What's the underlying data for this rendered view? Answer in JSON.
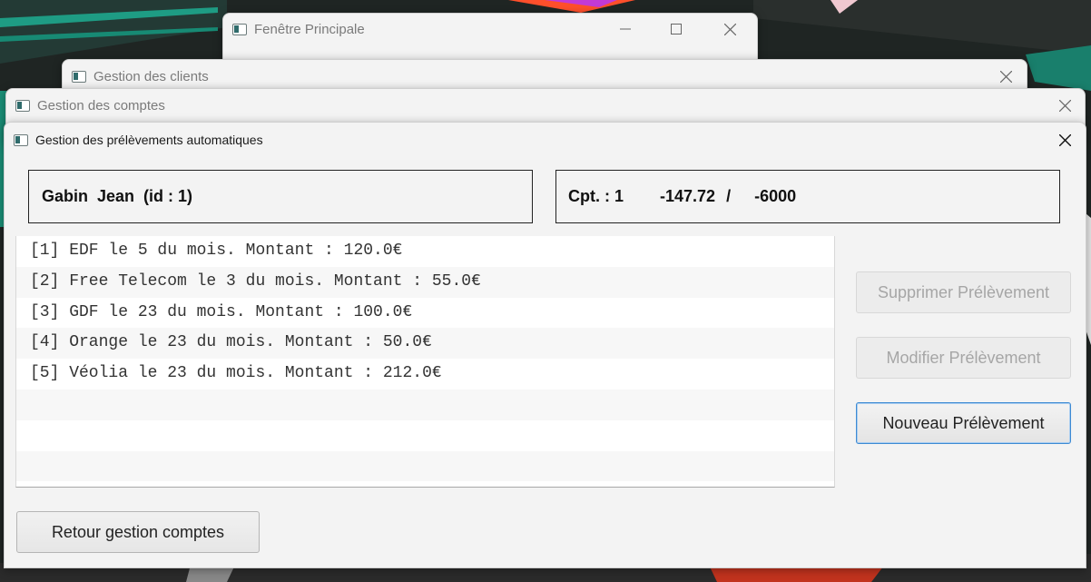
{
  "windows": {
    "principal": {
      "title": "Fenêtre Principale"
    },
    "clients": {
      "title": "Gestion des clients"
    },
    "comptes": {
      "title": "Gestion des comptes"
    },
    "prelevements": {
      "title": "Gestion des prélèvements automatiques"
    }
  },
  "client_info": {
    "label": "Gabin  Jean  (id : 1)"
  },
  "account_info": {
    "label": "Cpt. : 1",
    "balance": "-147.72",
    "separator": "/",
    "overdraft": "-6000"
  },
  "prelevements": [
    "[1] EDF le 5 du mois. Montant : 120.0€",
    "[2] Free Telecom le 3 du mois. Montant : 55.0€",
    "[3] GDF le 23 du mois. Montant : 100.0€",
    "[4] Orange le 23 du mois. Montant : 50.0€",
    "[5] Véolia le 23 du mois. Montant : 212.0€",
    "",
    "",
    ""
  ],
  "buttons": {
    "supprimer": "Supprimer Prélèvement",
    "modifier": "Modifier Prélèvement",
    "nouveau": "Nouveau Prélèvement",
    "retour": "Retour gestion comptes"
  },
  "colors": {
    "focus_border": "#3d8ad3",
    "disabled_text": "#a6a6a6"
  }
}
